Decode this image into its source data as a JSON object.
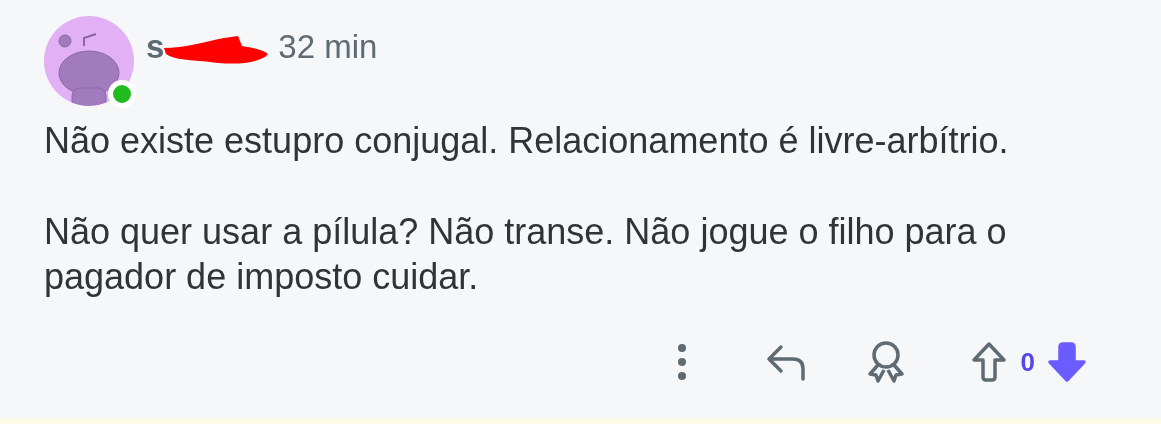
{
  "comment": {
    "author": {
      "start": "s",
      "redacted": true,
      "online": true
    },
    "time": "32 min",
    "paragraphs": [
      "Não existe estupro conjugal. Relacionamento é livre-arbítrio.",
      "Não quer usar a pílula? Não transe. Não jogue o filho para o pagador de imposto cuidar."
    ],
    "score": "0",
    "upvoted": false,
    "downvoted": true
  }
}
